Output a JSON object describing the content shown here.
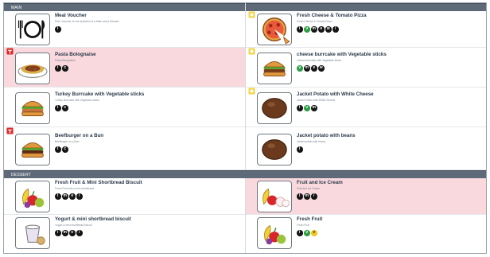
{
  "sections": {
    "main_label": "MAIN",
    "dessert_label": "DESSERT"
  },
  "items": [
    {
      "title": "Meal Voucher",
      "sub": "Plan: Voucher of one selection of a Main and a Dessert",
      "icons": [
        "info"
      ]
    },
    {
      "title": "Fresh Cheese & Tomato Pizza",
      "sub": "Fresh Cheese & Tomato Pizza",
      "icons": [
        "info",
        "vegetarian",
        "milk",
        "egg",
        "wheat",
        "mustard"
      ]
    },
    {
      "title": "Pasta Bolognaise",
      "sub": "Pasta Bolognaise",
      "icons": [
        "info",
        "celery"
      ]
    },
    {
      "title": "cheese burrcake with Vegetable sticks",
      "sub": "cheese burrcake with Vegetable sticks",
      "icons": [
        "vegetarian",
        "milk",
        "egg",
        "wheat"
      ]
    },
    {
      "title": "Turkey Burrcake with Vegetable sticks",
      "sub": "Turkey Burrcake with Vegetable sticks",
      "icons": [
        "info",
        "celery"
      ]
    },
    {
      "title": "Jacket Potato with White Cheese",
      "sub": "Jacket Potato with White Cheese",
      "icons": [
        "info",
        "vegetarian",
        "milk"
      ]
    },
    {
      "title": "Beefburger on a Bun",
      "sub": "Beefburger on a Bun",
      "icons": [
        "info",
        "celery"
      ]
    },
    {
      "title": "Jacket potato with beans",
      "sub": "Jacket potato with beans",
      "icons": [
        "info"
      ]
    },
    {
      "title": "Fresh Fruit & Mini Shortbread Biscuit",
      "sub": "Fresh Fruit with a mini shortbread",
      "icons": [
        "info",
        "milk",
        "egg",
        "mustard"
      ]
    },
    {
      "title": "Fruit and Ice Cream",
      "sub": "Fruit and Ice Cream",
      "icons": [
        "info",
        "milk",
        "mustard"
      ]
    },
    {
      "title": "Yogurt & mini shortbread biscuit",
      "sub": "Yogurt & mini shortbread biscuit",
      "icons": [
        "info",
        "milk",
        "egg",
        "mustard"
      ]
    },
    {
      "title": "Fresh Fruit",
      "sub": "Fresh Fruit",
      "icons": [
        "info",
        "vegetarian",
        "vegan"
      ]
    }
  ]
}
